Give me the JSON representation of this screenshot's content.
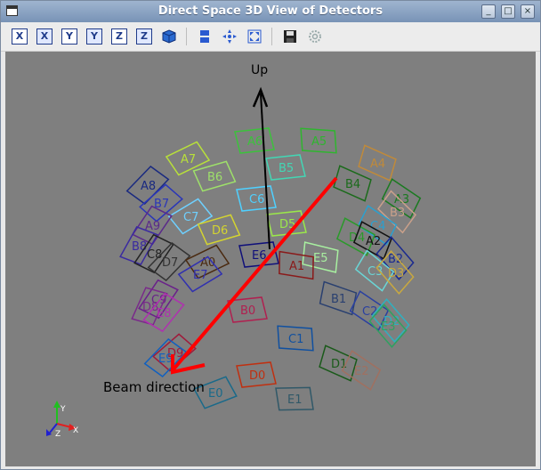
{
  "window": {
    "title": "Direct Space 3D View of Detectors",
    "minimize": "_",
    "maximize": "□",
    "close": "×"
  },
  "toolbar": {
    "view_buttons": [
      "X",
      "X",
      "Y",
      "Y",
      "Z",
      "Z"
    ]
  },
  "scene": {
    "up_label": "Up",
    "beam_label": "Beam direction",
    "axes": {
      "y": "Y",
      "z": "Z",
      "x": "X"
    }
  },
  "detectors": [
    {
      "label": "A6",
      "color": "#3cc23c"
    },
    {
      "label": "A5",
      "color": "#2fb52f"
    },
    {
      "label": "A7",
      "color": "#b8e03a"
    },
    {
      "label": "B6",
      "color": "#9ee06a"
    },
    {
      "label": "B5",
      "color": "#43d6b4"
    },
    {
      "label": "A4",
      "color": "#c08a3a"
    },
    {
      "label": "B4",
      "color": "#1b6b1b"
    },
    {
      "label": "A8",
      "color": "#1a2a80"
    },
    {
      "label": "B7",
      "color": "#2a36b8"
    },
    {
      "label": "C6",
      "color": "#4fd0ff"
    },
    {
      "label": "A3",
      "color": "#1a7a20"
    },
    {
      "label": "B3",
      "color": "#c9a08a"
    },
    {
      "label": "C7",
      "color": "#6ed0ff"
    },
    {
      "label": "D5",
      "color": "#9be84a"
    },
    {
      "label": "C4",
      "color": "#2aa0d0"
    },
    {
      "label": "D6",
      "color": "#d4d430"
    },
    {
      "label": "A9",
      "color": "#5a2a8a"
    },
    {
      "label": "D4",
      "color": "#2a9a2a"
    },
    {
      "label": "A2",
      "color": "#111111"
    },
    {
      "label": "B8",
      "color": "#3a2aa0"
    },
    {
      "label": "E6",
      "color": "#10107a"
    },
    {
      "label": "E5",
      "color": "#a8f0a0"
    },
    {
      "label": "C8",
      "color": "#222222"
    },
    {
      "label": "D7",
      "color": "#333333"
    },
    {
      "label": "A0",
      "color": "#4a2a10"
    },
    {
      "label": "A1",
      "color": "#8a1a1a"
    },
    {
      "label": "B2",
      "color": "#1a2a90"
    },
    {
      "label": "C3",
      "color": "#6ad6d6"
    },
    {
      "label": "D3",
      "color": "#c8a840"
    },
    {
      "label": "E7",
      "color": "#3030b0"
    },
    {
      "label": "C9",
      "color": "#6a208a"
    },
    {
      "label": "B1",
      "color": "#2a4070"
    },
    {
      "label": "D8",
      "color": "#7a2a8a"
    },
    {
      "label": "E8",
      "color": "#b030b0"
    },
    {
      "label": "B0",
      "color": "#b02050"
    },
    {
      "label": "C2",
      "color": "#2a40a0"
    },
    {
      "label": "D2",
      "color": "#30b0c0"
    },
    {
      "label": "E3",
      "color": "#30a060"
    },
    {
      "label": "C1",
      "color": "#1050a0"
    },
    {
      "label": "D9",
      "color": "#a01a3a"
    },
    {
      "label": "E9",
      "color": "#1060c0"
    },
    {
      "label": "D1",
      "color": "#1a5a1a"
    },
    {
      "label": "E2",
      "color": "#a07060"
    },
    {
      "label": "D0",
      "color": "#c03010"
    },
    {
      "label": "E0",
      "color": "#1a6a8a"
    },
    {
      "label": "E1",
      "color": "#305868"
    }
  ]
}
